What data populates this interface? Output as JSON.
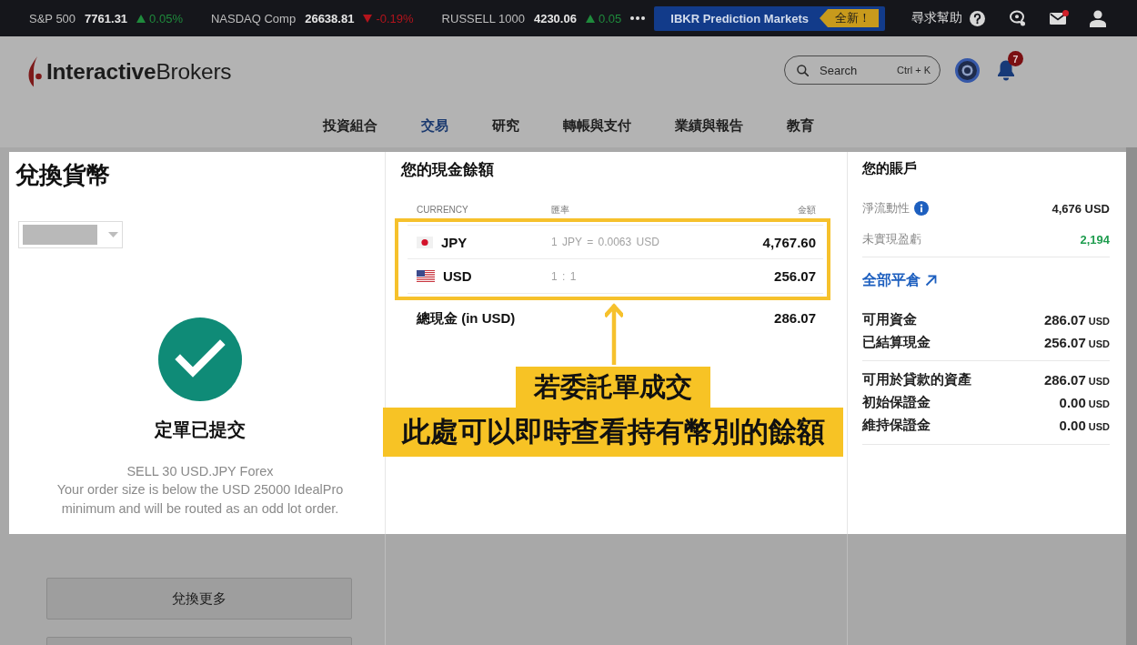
{
  "ticker": [
    {
      "name": "S&P 500",
      "value": "7761.31",
      "change": "0.05%",
      "kind": "up"
    },
    {
      "name": "NASDAQ Comp",
      "value": "26638.81",
      "change": "-0.19%",
      "kind": "down"
    },
    {
      "name": "RUSSELL 1000",
      "value": "4230.06",
      "change": "0.05",
      "kind": "up"
    }
  ],
  "top_bar": {
    "promo": {
      "label": "IBKR Prediction Markets",
      "badge": "全新！"
    },
    "help": "尋求幫助",
    "mail_unread": true
  },
  "header": {
    "logo": "**Interactive**Brokers",
    "search": {
      "placeholder": "Search",
      "shortcut": "Ctrl + K"
    },
    "notifications": "7"
  },
  "nav": [
    {
      "label": "投資組合",
      "selected": false
    },
    {
      "label": "交易",
      "selected": true
    },
    {
      "label": "研究",
      "selected": false
    },
    {
      "label": "轉帳與支付",
      "selected": false
    },
    {
      "label": "業績與報告",
      "selected": false
    },
    {
      "label": "教育",
      "selected": false
    }
  ],
  "convert": {
    "title": "兌換貨幣",
    "status": "定單已提交",
    "order": "SELL 30 USD.JPY Forex",
    "message": "Your order size is below the USD 25000 IdealPro minimum and will be routed as an odd lot order.",
    "buttons": [
      {
        "kind": "labelled",
        "label": "兌換更多"
      },
      {
        "kind": "plain"
      }
    ]
  },
  "cash": {
    "title": "您的現金餘額",
    "columns": [
      "CURRENCY",
      "匯率",
      "金額"
    ],
    "rows": [
      {
        "kind": "japan",
        "currency": "JPY",
        "rate": "1 JPY = 0.0063 USD",
        "amount": "4,767.60"
      },
      {
        "kind": "usa",
        "currency": "USD",
        "rate": "1 : 1",
        "amount": "256.07"
      }
    ],
    "total": {
      "label": "總現金 (in USD)",
      "value": "286.07"
    }
  },
  "account": {
    "title": "您的賬戶",
    "metrics": [
      {
        "label": "淨流動性",
        "info": true,
        "value": "4,676 USD",
        "color": "#222222"
      },
      {
        "label": "未實現盈虧",
        "info": false,
        "value": "2,194",
        "color": "#1f9d4f"
      }
    ],
    "link": "全部平倉",
    "groups": [
      {
        "rows": [
          {
            "label": "可用資金",
            "value": "286.07",
            "unit": "USD"
          },
          {
            "label": "已結算現金",
            "value": "256.07",
            "unit": "USD"
          }
        ]
      },
      {
        "rows": [
          {
            "label": "可用於貸款的資產",
            "value": "286.07",
            "unit": "USD"
          },
          {
            "label": "初始保證金",
            "value": "0.00",
            "unit": "USD"
          },
          {
            "label": "維持保證金",
            "value": "0.00",
            "unit": "USD"
          }
        ]
      }
    ]
  },
  "annotation": {
    "highlight_rows": true,
    "lines": [
      "若委託單成交",
      "此處可以即時查看持有幣別的餘額"
    ]
  }
}
